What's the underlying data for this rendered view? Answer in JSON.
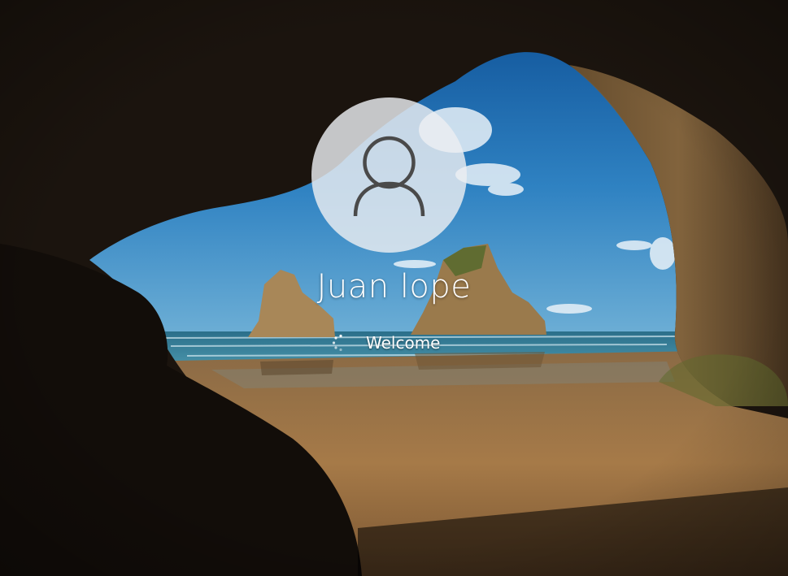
{
  "lock_screen": {
    "user_name": "Juan lope",
    "status_text": "Welcome"
  },
  "icons": {
    "avatar": "user-silhouette-icon",
    "spinner": "loading-dots-spinner-icon"
  },
  "colors": {
    "sky": "#1f6fb0",
    "sea": "#2e8aa6",
    "sand": "#9c7141",
    "rock": "#2a1f16",
    "avatar_bg": "#e6e9ee",
    "text": "#ffffff"
  }
}
